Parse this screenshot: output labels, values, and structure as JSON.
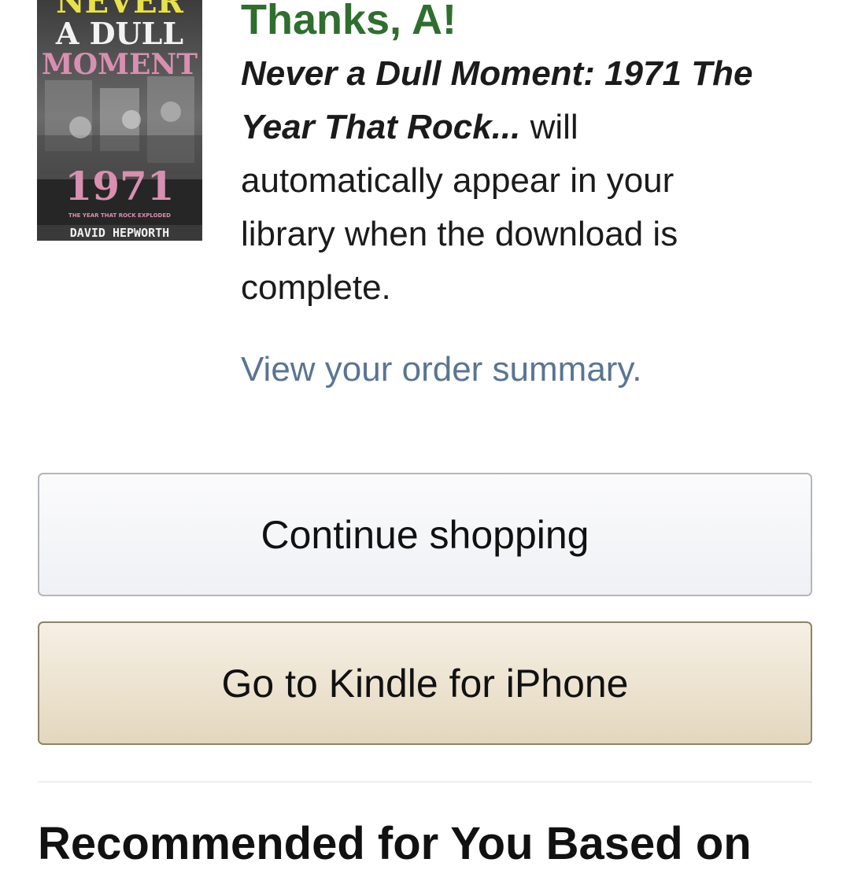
{
  "book": {
    "cover": {
      "line1": "NEVER",
      "line2": "A DULL",
      "line3": "MOMENT",
      "year": "1971",
      "tagline": "THE YEAR THAT ROCK EXPLODED",
      "author": "DAVID HEPWORTH"
    },
    "title": "Never a Dull Moment: 1971 The Year That Rock..."
  },
  "confirmation": {
    "thanks": "Thanks, A!",
    "message_suffix": " will automatically appear in your library when the download is complete.",
    "order_link": "View your order summary."
  },
  "buttons": {
    "continue_label": "Continue shopping",
    "kindle_label": "Go to Kindle for iPhone"
  },
  "recommendations": {
    "heading": "Recommended for You Based on"
  },
  "colors": {
    "thanks_green": "#2f6e2f",
    "link_blue": "#5a7593",
    "cover_yellow": "#e8e24a",
    "cover_pink": "#d98fb0"
  }
}
